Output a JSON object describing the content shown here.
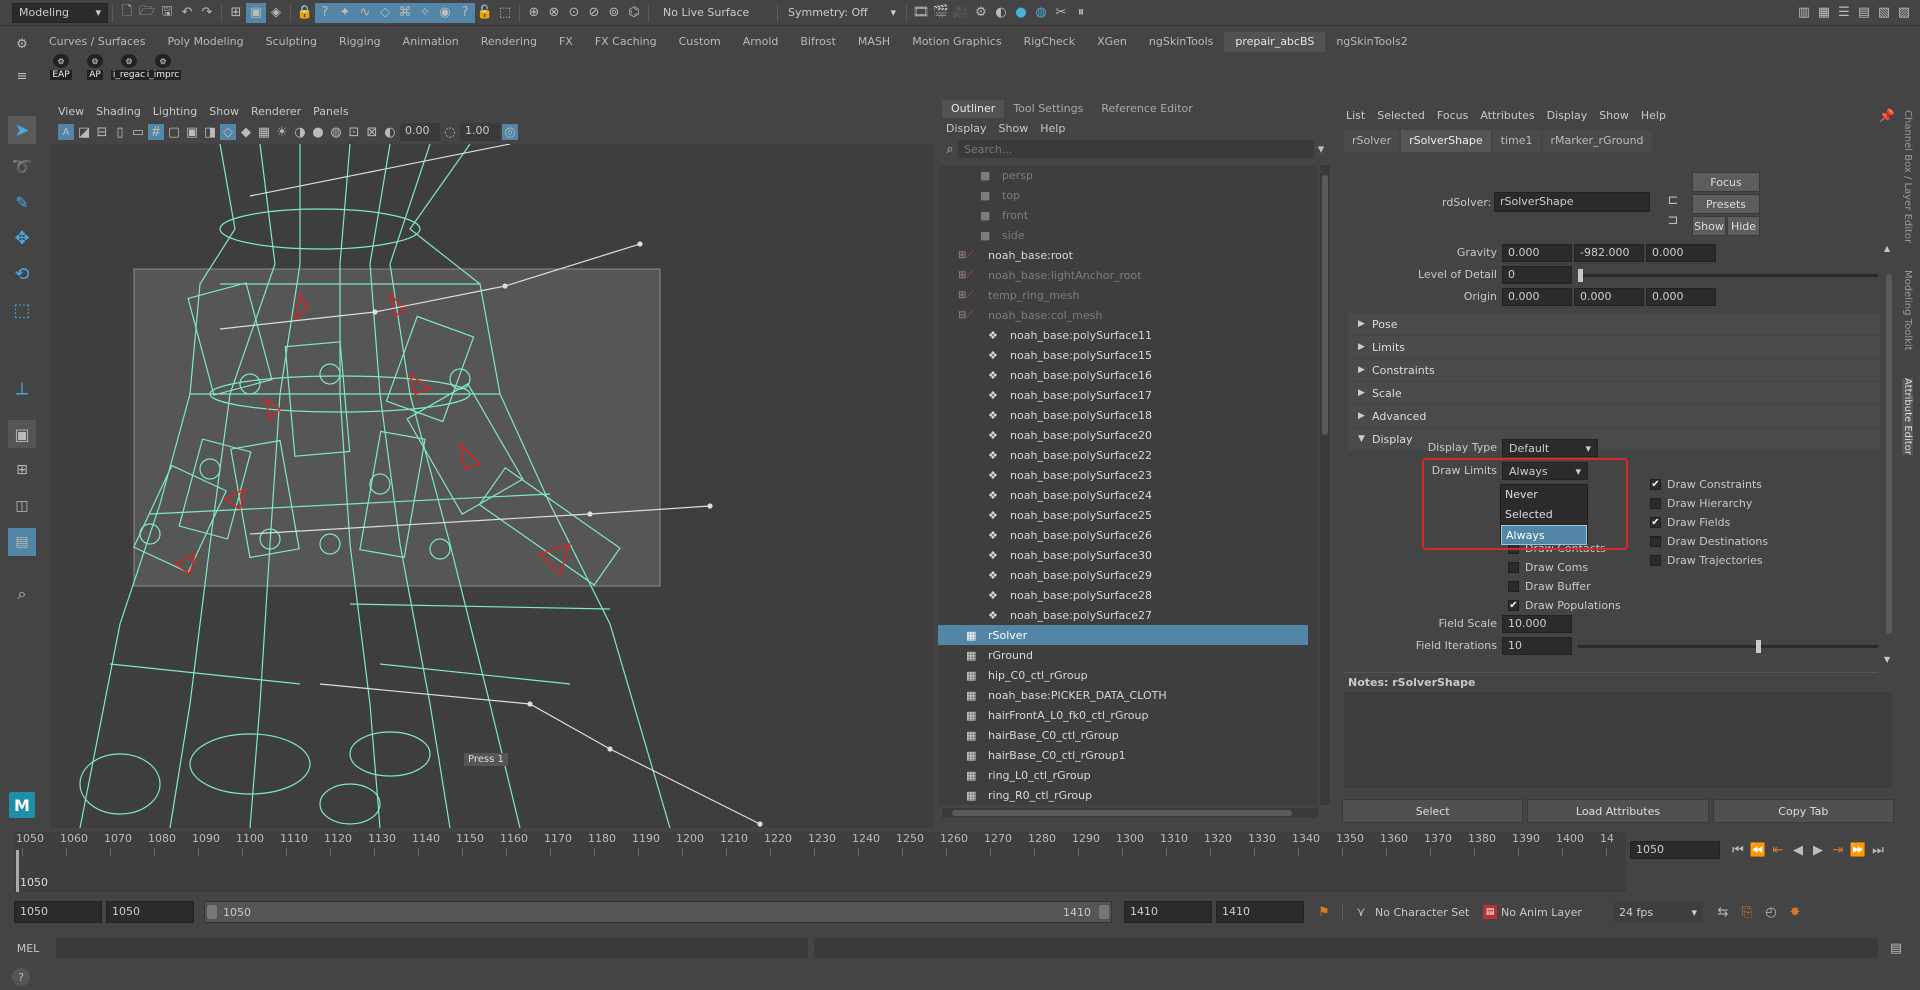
{
  "topbar": {
    "mode": "Modeling",
    "live_surface": "No Live Surface",
    "symmetry": "Symmetry: Off"
  },
  "shelf": {
    "tabs": [
      "Curves / Surfaces",
      "Poly Modeling",
      "Sculpting",
      "Rigging",
      "Animation",
      "Rendering",
      "FX",
      "FX Caching",
      "Custom",
      "Arnold",
      "Bifrost",
      "MASH",
      "Motion Graphics",
      "RigCheck",
      "XGen",
      "ngSkinTools",
      "prepair_abcBS",
      "ngSkinTools2"
    ],
    "active_tab": "prepair_abcBS",
    "buttons": [
      "EAP",
      "AP",
      "i_regac",
      "i_imprc"
    ]
  },
  "viewport": {
    "menu": [
      "View",
      "Shading",
      "Lighting",
      "Show",
      "Renderer",
      "Panels"
    ],
    "field_a": "0.00",
    "field_b": "1.00",
    "hud_label": "Press 1"
  },
  "outliner": {
    "tabs": [
      "Outliner",
      "Tool Settings",
      "Reference Editor"
    ],
    "menu": [
      "Display",
      "Show",
      "Help"
    ],
    "search_placeholder": "Search...",
    "items": [
      {
        "label": "persp",
        "indent": 1,
        "style": "dim"
      },
      {
        "label": "top",
        "indent": 1,
        "style": "dim"
      },
      {
        "label": "front",
        "indent": 1,
        "style": "dim"
      },
      {
        "label": "side",
        "indent": 1,
        "style": "dim"
      },
      {
        "label": "noah_base:root",
        "indent": 0,
        "style": ""
      },
      {
        "label": "noah_base:lightAnchor_root",
        "indent": 0,
        "style": "dim"
      },
      {
        "label": "temp_ring_mesh",
        "indent": 0,
        "style": "dim"
      },
      {
        "label": "noah_base:col_mesh",
        "indent": 0,
        "style": "dim"
      },
      {
        "label": "noah_base:polySurface11",
        "indent": 2,
        "style": ""
      },
      {
        "label": "noah_base:polySurface15",
        "indent": 2,
        "style": ""
      },
      {
        "label": "noah_base:polySurface16",
        "indent": 2,
        "style": ""
      },
      {
        "label": "noah_base:polySurface17",
        "indent": 2,
        "style": ""
      },
      {
        "label": "noah_base:polySurface18",
        "indent": 2,
        "style": ""
      },
      {
        "label": "noah_base:polySurface20",
        "indent": 2,
        "style": ""
      },
      {
        "label": "noah_base:polySurface22",
        "indent": 2,
        "style": ""
      },
      {
        "label": "noah_base:polySurface23",
        "indent": 2,
        "style": ""
      },
      {
        "label": "noah_base:polySurface24",
        "indent": 2,
        "style": ""
      },
      {
        "label": "noah_base:polySurface25",
        "indent": 2,
        "style": ""
      },
      {
        "label": "noah_base:polySurface26",
        "indent": 2,
        "style": ""
      },
      {
        "label": "noah_base:polySurface30",
        "indent": 2,
        "style": ""
      },
      {
        "label": "noah_base:polySurface29",
        "indent": 2,
        "style": ""
      },
      {
        "label": "noah_base:polySurface28",
        "indent": 2,
        "style": ""
      },
      {
        "label": "noah_base:polySurface27",
        "indent": 2,
        "style": ""
      },
      {
        "label": "rSolver",
        "indent": 0,
        "style": "sel"
      },
      {
        "label": "rGround",
        "indent": 0,
        "style": ""
      },
      {
        "label": "hip_C0_ctl_rGroup",
        "indent": 0,
        "style": ""
      },
      {
        "label": "noah_base:PICKER_DATA_CLOTH",
        "indent": 0,
        "style": ""
      },
      {
        "label": "hairFrontA_L0_fk0_ctl_rGroup",
        "indent": 0,
        "style": ""
      },
      {
        "label": "hairBase_C0_ctl_rGroup",
        "indent": 0,
        "style": ""
      },
      {
        "label": "hairBase_C0_ctl_rGroup1",
        "indent": 0,
        "style": ""
      },
      {
        "label": "ring_L0_ctl_rGroup",
        "indent": 0,
        "style": ""
      },
      {
        "label": "ring_R0_ctl_rGroup",
        "indent": 0,
        "style": ""
      }
    ]
  },
  "attr_editor": {
    "menu": [
      "List",
      "Selected",
      "Focus",
      "Attributes",
      "Display",
      "Show",
      "Help"
    ],
    "tabs": [
      "rSolver",
      "rSolverShape",
      "time1",
      "rMarker_rGround"
    ],
    "active_tab": "rSolverShape",
    "node_label": "rdSolver:",
    "node_value": "rSolverShape",
    "focus_btn": "Focus",
    "presets_btn": "Presets",
    "show_btn": "Show",
    "hide_btn": "Hide",
    "gravity_label": "Gravity",
    "gravity": [
      "0.000",
      "-982.000",
      "0.000"
    ],
    "lod_label": "Level of Detail",
    "lod": "0",
    "origin_label": "Origin",
    "origin": [
      "0.000",
      "0.000",
      "0.000"
    ],
    "sections": [
      "Pose",
      "Limits",
      "Constraints",
      "Scale",
      "Advanced",
      "Display"
    ],
    "display_type_label": "Display Type",
    "display_type": "Default",
    "draw_limits_label": "Draw Limits",
    "draw_limits": "Always",
    "dropdown_options": [
      "Never",
      "Selected",
      "Always"
    ],
    "left_checks": [
      {
        "label": "Draw Contacts",
        "checked": false
      },
      {
        "label": "Draw Coms",
        "checked": false
      },
      {
        "label": "Draw Buffer",
        "checked": false
      },
      {
        "label": "Draw Populations",
        "checked": true
      }
    ],
    "right_checks": [
      {
        "label": "Draw Constraints",
        "checked": true
      },
      {
        "label": "Draw Hierarchy",
        "checked": false
      },
      {
        "label": "Draw Fields",
        "checked": true
      },
      {
        "label": "Draw Destinations",
        "checked": false
      },
      {
        "label": "Draw Trajectories",
        "checked": false
      }
    ],
    "field_scale_label": "Field Scale",
    "field_scale": "10.000",
    "field_iter_label": "Field Iterations",
    "field_iter": "10",
    "notes": "Notes:  rSolverShape",
    "bottom_buttons": [
      "Select",
      "Load Attributes",
      "Copy Tab"
    ],
    "side_tabs": [
      "Channel Box / Layer Editor",
      "Modeling Toolkit",
      "Attribute Editor"
    ]
  },
  "timeline": {
    "ticks": [
      "1050",
      "1060",
      "1070",
      "1080",
      "1090",
      "1100",
      "1110",
      "1120",
      "1130",
      "1140",
      "1150",
      "1160",
      "1170",
      "1180",
      "1190",
      "1200",
      "1210",
      "1220",
      "1230",
      "1240",
      "1250",
      "1260",
      "1270",
      "1280",
      "1290",
      "1300",
      "1310",
      "1320",
      "1330",
      "1340",
      "1350",
      "1360",
      "1370",
      "1380",
      "1390",
      "1400",
      "14"
    ],
    "current_marker": "1050",
    "current_frame": "1050"
  },
  "range": {
    "start": "1050",
    "playback_start": "1050",
    "slider_start": "1050",
    "slider_end": "1410",
    "playback_end": "1410",
    "end": "1410",
    "character_set": "No Character Set",
    "anim_layer": "No Anim Layer",
    "fps": "24 fps"
  },
  "command": {
    "label": "MEL"
  },
  "colors": {
    "wire": "#7fe8c4",
    "selection": "#5285a6",
    "highlight_box": "#d42a2a",
    "joint": "#e02020"
  }
}
